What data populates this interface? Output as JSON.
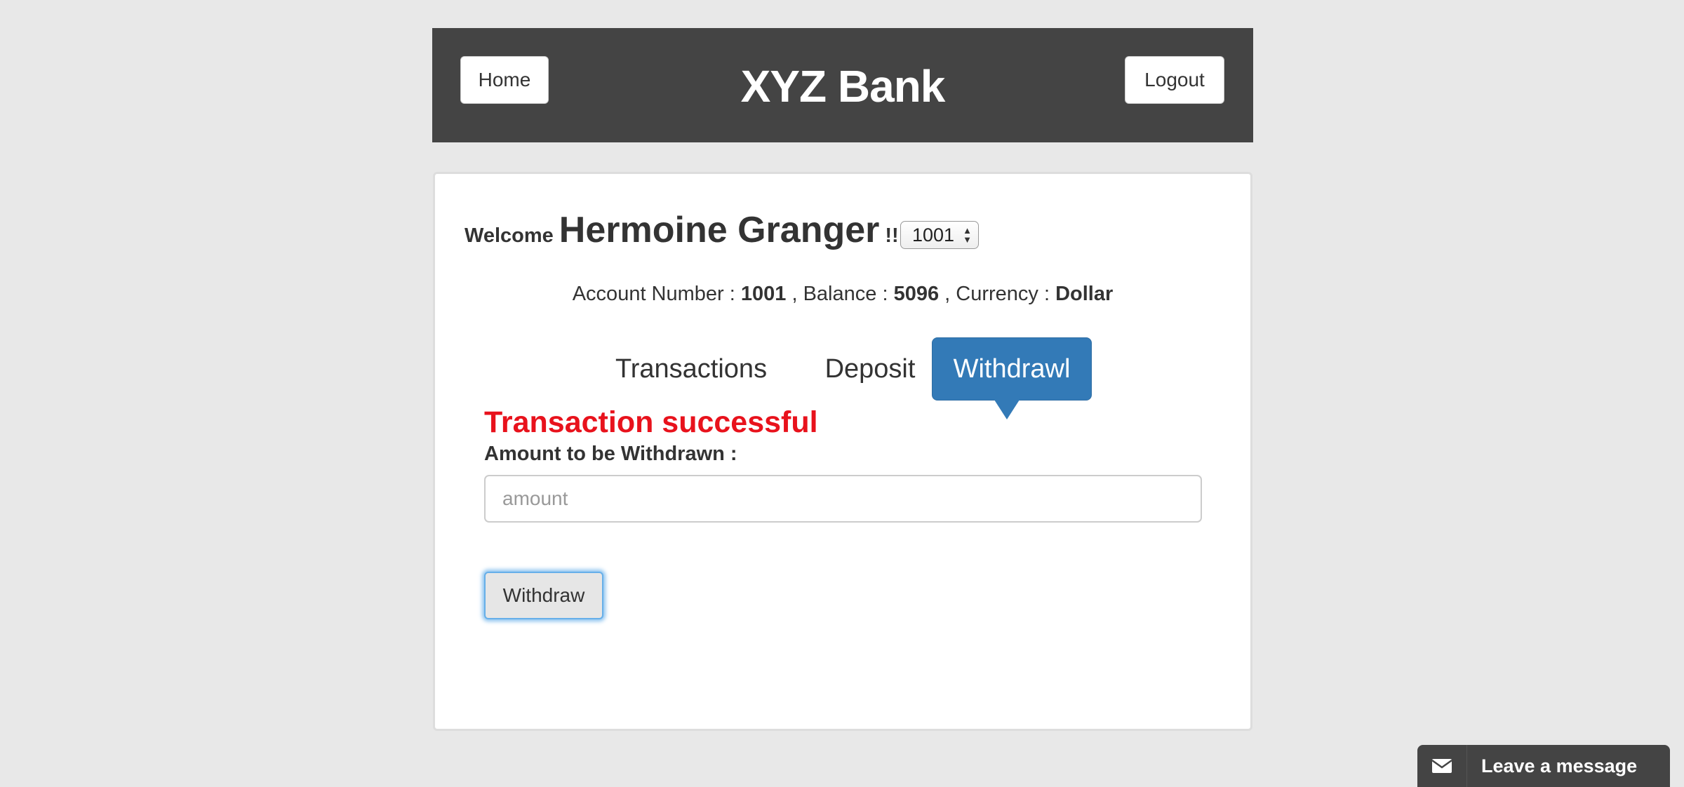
{
  "header": {
    "home_label": "Home",
    "title": "XYZ Bank",
    "logout_label": "Logout"
  },
  "customer": {
    "welcome": "Welcome",
    "name": "Hermoine Granger",
    "exclaim": "!!",
    "selected_account": "1001"
  },
  "account_info": {
    "account_number_label": "Account Number :",
    "account_number": "1001",
    "balance_label": ", Balance :",
    "balance": "5096",
    "currency_label": ", Currency :",
    "currency": "Dollar"
  },
  "tabs": [
    {
      "label": "Transactions",
      "active": false
    },
    {
      "label": "Deposit",
      "active": false
    },
    {
      "label": "Withdrawl",
      "active": true
    }
  ],
  "withdraw_form": {
    "message": "Transaction successful",
    "amount_label": "Amount to be Withdrawn :",
    "amount_value": "",
    "amount_placeholder": "amount",
    "submit_label": "Withdraw"
  },
  "chat_widget": {
    "label": "Leave a message",
    "icon": "envelope-icon"
  },
  "colors": {
    "header_bg": "#444444",
    "active_tab": "#337ab7",
    "success_message": "#e8121c",
    "page_bg": "#e8e8e8"
  }
}
